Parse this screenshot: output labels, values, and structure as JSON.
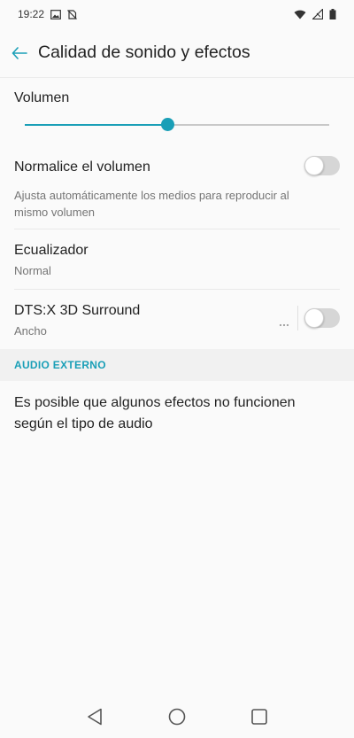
{
  "status_bar": {
    "time": "19:22",
    "icons": [
      "image-icon",
      "no-sync-icon",
      "wifi-icon",
      "signal-icon",
      "battery-icon"
    ]
  },
  "app_bar": {
    "title": "Calidad de sonido y efectos",
    "back_icon": "arrow-left-icon"
  },
  "volume": {
    "label": "Volumen",
    "level": 0.47
  },
  "normalize": {
    "label": "Normalice el volumen",
    "description_line1": "Ajusta automáticamente los medios para reproducir al",
    "description_line2": "mismo volumen",
    "enabled": false
  },
  "equalizer": {
    "label": "Ecualizador",
    "value": "Normal"
  },
  "dts": {
    "label": "DTS:X 3D Surround",
    "value": "Ancho",
    "more_icon": "more-dots-icon",
    "enabled": false
  },
  "external_audio": {
    "header": "AUDIO EXTERNO",
    "note_line1": "Es posible que algunos efectos no funcionen",
    "note_line2": "según el tipo de audio"
  },
  "nav_bar": {
    "icons": [
      "back-triangle-icon",
      "home-circle-icon",
      "recents-square-icon"
    ]
  },
  "colors": {
    "accent": "#1a9fb7",
    "background": "#fafafa",
    "toggle_off": "#d6d6d6"
  }
}
